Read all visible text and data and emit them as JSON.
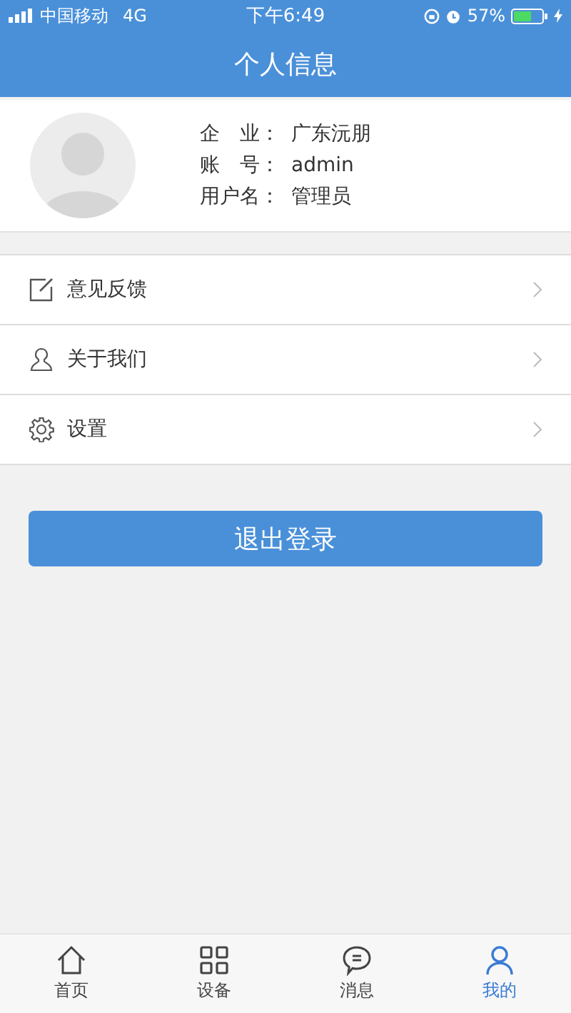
{
  "status_bar": {
    "carrier": "中国移动",
    "network": "4G",
    "time": "下午6:49",
    "battery": "57%"
  },
  "header": {
    "title": "个人信息"
  },
  "profile": {
    "fields": [
      {
        "label": "企　业：",
        "value": "广东沅朋"
      },
      {
        "label": "账　号：",
        "value": "admin"
      },
      {
        "label": "用户名：",
        "value": "管理员"
      }
    ]
  },
  "menu": [
    {
      "kind": "feedback",
      "label": "意见反馈"
    },
    {
      "kind": "about",
      "label": "关于我们"
    },
    {
      "kind": "settings",
      "label": "设置"
    }
  ],
  "logout_button": "退出登录",
  "tab_bar": [
    {
      "kind": "home",
      "label": "首页",
      "selected": false
    },
    {
      "kind": "devices",
      "label": "设备",
      "selected": false
    },
    {
      "kind": "messages",
      "label": "消息",
      "selected": false
    },
    {
      "kind": "mine",
      "label": "我的",
      "selected": true
    }
  ]
}
